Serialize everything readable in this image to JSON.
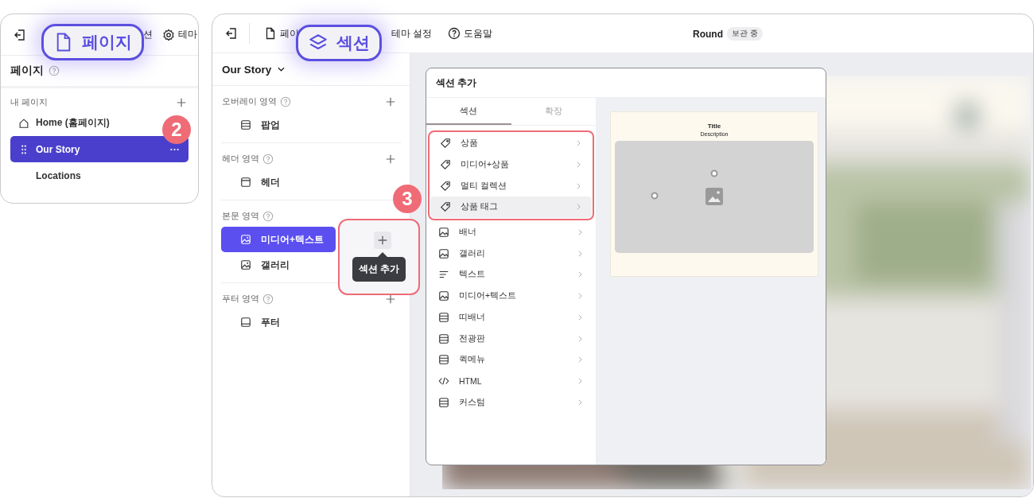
{
  "left_panel": {
    "toolbar": {
      "items": [
        {
          "label": "션"
        },
        {
          "label": "테마"
        }
      ]
    },
    "title": "페이지",
    "group_label": "내 페이지",
    "pages": [
      {
        "label": "Home (홈페이지)",
        "kind": "home",
        "selected": false
      },
      {
        "label": "Our Story",
        "kind": "drag",
        "selected": true
      },
      {
        "label": "Locations",
        "kind": "plain",
        "selected": false
      }
    ]
  },
  "right_panel": {
    "toolbar": {
      "items": [
        {
          "label": "페이"
        },
        {
          "label": "테마 설정"
        },
        {
          "label": "도움말"
        }
      ]
    },
    "site_name": "Round",
    "site_status": "보관 중",
    "page_selector": "Our Story",
    "areas": [
      {
        "title": "오버레이 영역",
        "items": [
          {
            "label": "팝업",
            "kind": "popup",
            "selected": false
          }
        ]
      },
      {
        "title": "헤더 영역",
        "items": [
          {
            "label": "헤더",
            "kind": "header",
            "selected": false
          }
        ]
      },
      {
        "title": "본문 영역",
        "items": [
          {
            "label": "미디어+텍스트",
            "kind": "media",
            "selected": true
          },
          {
            "label": "갤러리",
            "kind": "media",
            "selected": false
          }
        ]
      },
      {
        "title": "푸터 영역",
        "items": [
          {
            "label": "푸터",
            "kind": "footer",
            "selected": false
          }
        ]
      }
    ],
    "tooltip": "섹션 추가",
    "dialog": {
      "title": "섹션 추가",
      "tabs": [
        {
          "label": "섹션",
          "selected": true
        },
        {
          "label": "확장",
          "selected": false
        }
      ],
      "groups": [
        {
          "highlighted": true,
          "items": [
            {
              "label": "상품",
              "kind": "product",
              "selected": false
            },
            {
              "label": "미디어+상품",
              "kind": "product",
              "selected": false
            },
            {
              "label": "멀티 컬렉션",
              "kind": "product",
              "selected": false
            },
            {
              "label": "상품 태그",
              "kind": "product",
              "selected": true
            }
          ]
        },
        {
          "highlighted": false,
          "items": [
            {
              "label": "배너",
              "kind": "media",
              "selected": false
            },
            {
              "label": "갤러리",
              "kind": "media",
              "selected": false
            },
            {
              "label": "텍스트",
              "kind": "text",
              "selected": false
            },
            {
              "label": "미디어+텍스트",
              "kind": "media",
              "selected": false
            },
            {
              "label": "띠배너",
              "kind": "layout",
              "selected": false
            },
            {
              "label": "전광판",
              "kind": "layout",
              "selected": false
            },
            {
              "label": "퀵메뉴",
              "kind": "layout",
              "selected": false
            },
            {
              "label": "HTML",
              "kind": "code",
              "selected": false
            },
            {
              "label": "커스텀",
              "kind": "layout",
              "selected": false
            }
          ]
        }
      ],
      "preview": {
        "title": "Title",
        "description": "Description"
      }
    }
  },
  "callouts": [
    {
      "label": "페이지"
    },
    {
      "label": "섹션"
    }
  ],
  "step_badges": [
    "2",
    "3"
  ]
}
